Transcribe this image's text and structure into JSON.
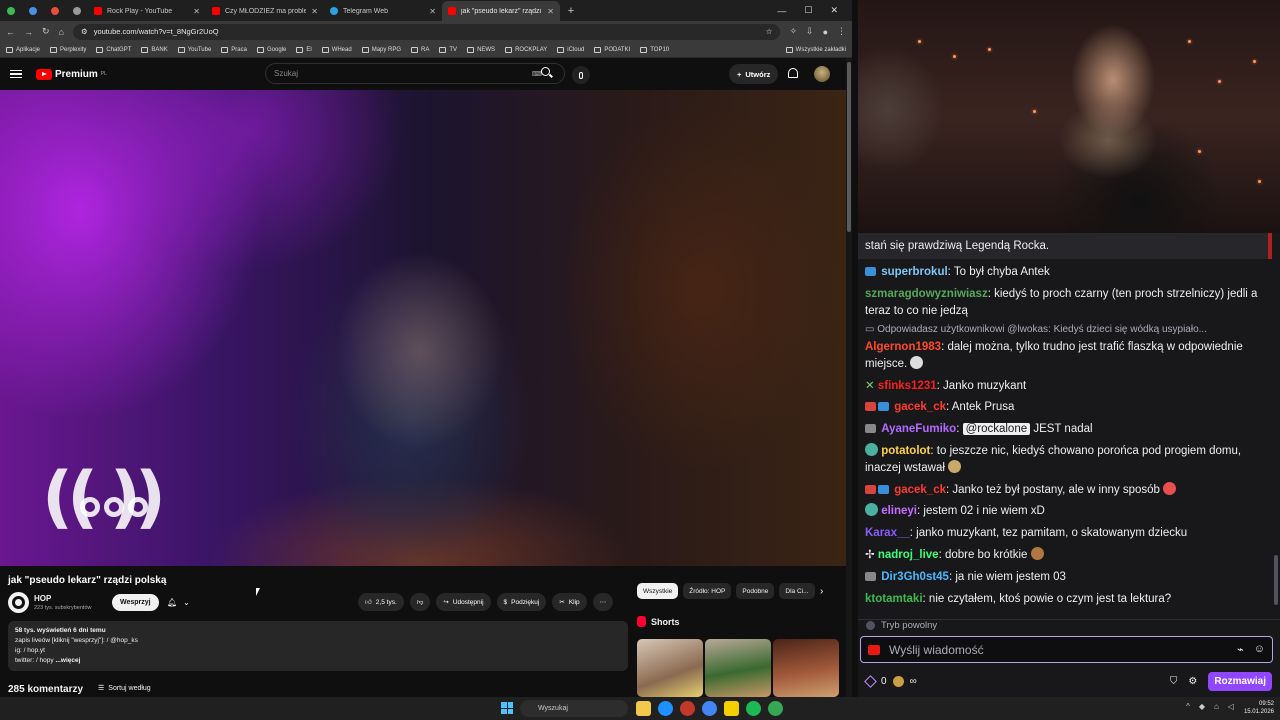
{
  "browser": {
    "tabs": [
      {
        "label": "Rock Play - YouTube",
        "color": "#ff0000",
        "active": false
      },
      {
        "label": "Czy MŁODZIEŻ ma problem pr...",
        "color": "#ff0000",
        "active": false
      },
      {
        "label": "Telegram Web",
        "color": "#2aa3e0",
        "active": false
      },
      {
        "label": "jak \"pseudo lekarz\" rządzi p...",
        "color": "#ff0000",
        "active": true
      }
    ],
    "url": "youtube.com/watch?v=t_8NgGr2UoQ",
    "bookmarks": [
      "Aplikacje",
      "Perplexity",
      "ChatGPT",
      "BANK",
      "YouTube",
      "Praca",
      "Google",
      "El",
      "WHead",
      "Mapy RPG",
      "RA",
      "TV",
      "NEWS",
      "ROCKPLAY",
      "iCloud",
      "PODATKI",
      "TOP10"
    ],
    "all_bookmarks": "Wszystkie zakładki"
  },
  "youtube": {
    "logo_text": "Premium",
    "logo_sup": "PL",
    "search_placeholder": "Szukaj",
    "create_label": "Utwórz",
    "video_title": "jak \"pseudo lekarz\" rządzi polską",
    "channel_name": "HOP",
    "channel_subs": "223 tys. subskrybentów",
    "support_label": "Wesprzyj",
    "likes": "2,5 tys.",
    "share_label": "Udostępnij",
    "thanks_label": "Podziękuj",
    "clip_label": "Klip",
    "description": {
      "stats": "58 tys. wyświetleń  6 dni temu",
      "line1": "zapis liveów [kliknij \"wesprzyj\"]:  / @hop_ks",
      "line2": "ig:  / hop.yt",
      "line3": "twitter:  / hopy",
      "more": "...więcej"
    },
    "comments_count": "285 komentarzy",
    "sort_label": "Sortuj według",
    "chips": [
      "Wszystkie",
      "Źródło: HOP",
      "Podobne",
      "Dla Ci..."
    ],
    "shorts_label": "Shorts"
  },
  "chat": {
    "highlight": "stań się prawdziwą Legendą Rocka.",
    "messages": [
      {
        "user": "superbrokul",
        "color": "#7ec8f8",
        "text": ": To był chyba Antek"
      },
      {
        "user": "szmaragdowyzniwiasz",
        "color": "#57a85a",
        "text": ": kiedyś to proch czarny (ten proch strzelniczy) jedli a teraz to co nie jedzą"
      },
      {
        "user": "Algernon1983",
        "color": "#ff4a28",
        "text": ": dalej można, tylko trudno jest trafić flaszką w odpowiednie miejsce."
      },
      {
        "user": "sfinks1231",
        "color": "#ff1e1e",
        "text": ": Janko muzykant"
      },
      {
        "user": "gacek_ck",
        "color": "#ff3b2f",
        "text": ": Antek Prusa"
      },
      {
        "user": "AyaneFumiko",
        "color": "#b36bff",
        "mention": "@rockalone",
        "text": " JEST nadal"
      },
      {
        "user": "potatolot",
        "color": "#ffd24a",
        "text": ": to jeszcze nic, kiedyś chowano porońca pod progiem domu, inaczej wstawał"
      },
      {
        "user": "gacek_ck",
        "color": "#ff3b2f",
        "text": ": Janko też był postany, ale w inny sposób"
      },
      {
        "user": "elineyi",
        "color": "#c86bff",
        "text": ": jestem 02 i nie wiem xD"
      },
      {
        "user": "Karax__",
        "color": "#8a5cff",
        "text": ": janko muzykant, tez pamitam, o skatowanym dziecku"
      },
      {
        "user": "nadroj_live",
        "color": "#3cff7a",
        "text": ": dobre bo krótkie"
      },
      {
        "user": "Dir3Gh0st45",
        "color": "#4ab8ff",
        "text": ": ja nie wiem jestem 03"
      },
      {
        "user": "ktotamtaki",
        "color": "#3fb950",
        "text": ": nie czytałem, ktoś powie o czym jest ta lektura?"
      }
    ],
    "reply_text": "Odpowiadasz użytkownikowi @lwokas: Kiedyś dzieci się wódką usypiało...",
    "slow_mode": "Tryb powolny",
    "input_placeholder": "Wyślij wiadomość",
    "points": "0",
    "send_label": "Rozmawiaj"
  },
  "taskbar": {
    "search": "Wyszukaj",
    "time": "09:52",
    "date": "15.01.2026"
  }
}
